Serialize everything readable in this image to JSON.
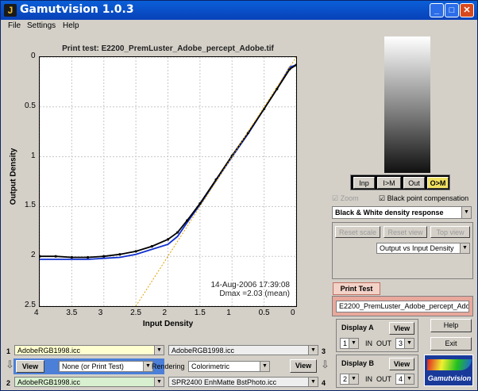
{
  "window": {
    "title": "Gamutvision 1.0.3",
    "app_icon": "J"
  },
  "menu": [
    "File",
    "Settings",
    "Help"
  ],
  "plot": {
    "title": "Print test: E2200_PremLuster_Adobe_percept_Adobe.tif",
    "ylabel": "Output Density",
    "xlabel": "Input Density",
    "x_ticks": [
      "4",
      "3.5",
      "3",
      "2.5",
      "2",
      "1.5",
      "1",
      "0.5",
      "0"
    ],
    "y_ticks": [
      "0",
      "0.5",
      "1",
      "1.5",
      "2",
      "2.5"
    ],
    "timestamp": "14-Aug-2006 17:39:08",
    "dmax": "Dmax =2.03 (mean)"
  },
  "chart_data": {
    "type": "line",
    "xlim": [
      4,
      0
    ],
    "ylim": [
      2.5,
      0
    ],
    "series": [
      {
        "color": "#1030d0",
        "x": [
          4,
          3.75,
          3.5,
          3.25,
          3.0,
          2.75,
          2.5,
          2.25,
          2.0,
          1.85,
          1.7,
          1.5,
          1.25,
          1.0,
          0.75,
          0.5,
          0.3,
          0.1,
          0.0
        ],
        "y": [
          2.03,
          2.03,
          2.03,
          2.03,
          2.02,
          2.01,
          1.98,
          1.93,
          1.88,
          1.8,
          1.66,
          1.48,
          1.24,
          1.0,
          0.77,
          0.52,
          0.32,
          0.1,
          0.08
        ]
      },
      {
        "color": "#000000",
        "x": [
          4,
          3.75,
          3.5,
          3.25,
          3.0,
          2.75,
          2.5,
          2.25,
          2.0,
          1.85,
          1.7,
          1.5,
          1.25,
          1.0,
          0.75,
          0.5,
          0.3,
          0.1,
          0.0
        ],
        "y": [
          2.0,
          2.0,
          2.01,
          2.01,
          2.0,
          1.98,
          1.95,
          1.9,
          1.83,
          1.76,
          1.64,
          1.47,
          1.23,
          0.99,
          0.76,
          0.52,
          0.32,
          0.12,
          0.08
        ]
      },
      {
        "color": "#e0a000",
        "x": [
          2.5,
          0.0
        ],
        "y": [
          2.5,
          0.0
        ]
      }
    ]
  },
  "view_buttons": [
    "Inp",
    "I>M",
    "Out",
    "O>M"
  ],
  "zoom_label": "Zoom",
  "bpc_label": "Black point compensation",
  "response_select": "Black & White density response",
  "reset_scale": "Reset scale",
  "reset_view": "Reset view",
  "top_view": "Top view",
  "axis_select": "Output vs Input Density",
  "print_test_label": "Print Test",
  "print_test_file": "E2200_PremLuster_Adobe_percept_Adobe.tif",
  "display_a": {
    "label": "Display A",
    "view": "View",
    "in": "1",
    "out": "3",
    "in_label": "IN",
    "out_label": "OUT"
  },
  "display_b": {
    "label": "Display B",
    "view": "View",
    "in": "2",
    "out": "4",
    "in_label": "IN",
    "out_label": "OUT"
  },
  "help": "Help",
  "exit": "Exit",
  "logo": "Gamutvision",
  "profiles": {
    "p1": "AdobeRGB1998.icc",
    "p2": "AdobeRGB1998.icc",
    "p3": "AdobeRGB1998.icc",
    "p4": "SPR2400 EnhMatte BstPhoto.icc",
    "num1": "1",
    "num2": "2",
    "num3": "3",
    "num4": "4",
    "view1": "View",
    "view2": "View",
    "mid_select": "None (or Print Test)",
    "rendering_label": "Rendering",
    "rendering": "Colorimetric"
  }
}
